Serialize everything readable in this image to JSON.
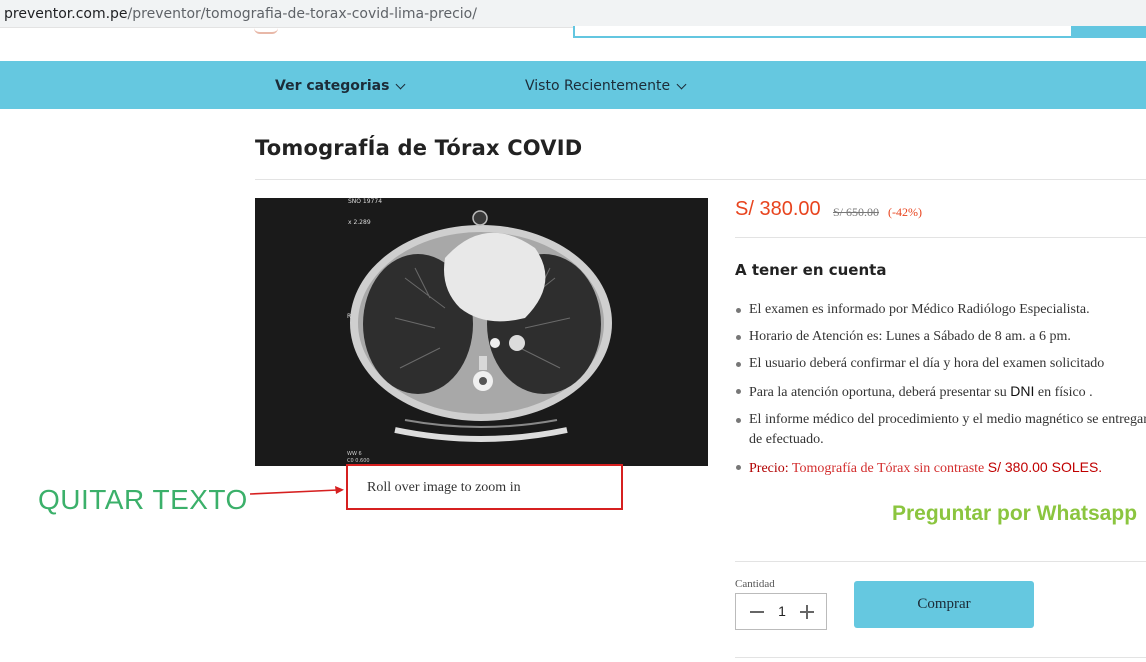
{
  "browser": {
    "url_host": "preventor.com.pe",
    "url_path": "/preventor/tomografia-de-torax-covid-lima-precio/"
  },
  "nav": {
    "categories": "Ver categorias",
    "recent": "Visto Recientemente"
  },
  "product": {
    "title": "TomografÍa de Tórax COVID",
    "image_alt": "CT scan of chest",
    "zoom_hint": "Roll over image to zoom in",
    "price": "S/ 380.00",
    "old_price": "S/ 650.00",
    "discount": "(-42%)",
    "notes_heading": "A tener en cuenta",
    "notes": [
      "El examen es informado por Médico Radiólogo Especialista.",
      "Horario de Atención es: Lunes a Sábado de 8 am. a 6 pm.",
      "El usuario deberá confirmar el día  y hora  del examen solicitado",
      "Para la atención oportuna, deberá presentar su",
      "El informe médico del procedimiento y el medio magnético se entregará",
      "de efectuado."
    ],
    "note_dni": "DNI",
    "note_dni_tail": " en físico .",
    "price_note_label": "Precio: ",
    "price_note_text": "Tomografía de Tórax sin contraste ",
    "price_note_amount": "S/ 380.00 SOLES.",
    "whatsapp": "Preguntar por Whatsapp",
    "qty_label": "Cantidad",
    "qty_value": "1",
    "buy_label": "Comprar"
  },
  "annotation": {
    "text": "QUITAR TEXTO",
    "color": "#3bb06a",
    "arrow_color": "#d62020"
  },
  "ct_overlay": {
    "top_left": "SNO 19774",
    "zoom": "x 2.289",
    "side": "R",
    "bottom1": "WW 6",
    "bottom2": "C0 0.600"
  },
  "colors": {
    "accent": "#65c8e0",
    "price": "#e8441e",
    "whatsapp": "#8bc53f"
  }
}
